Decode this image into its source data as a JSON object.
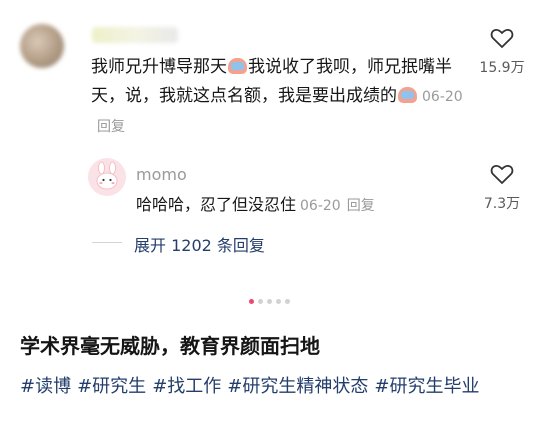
{
  "comment": {
    "text_parts": [
      "我师兄升博导那天",
      "我说收了我呗，师兄抿嘴半天，说，我就这点名额，我是要出成绩的"
    ],
    "date": "06-20",
    "reply_label": "回复",
    "like_count": "15.9万"
  },
  "sub_reply": {
    "username": "momo",
    "text": "哈哈哈，忍了但没忍住",
    "date": "06-20",
    "reply_label": "回复",
    "like_count": "7.3万"
  },
  "expand_label": "展开 1202 条回复",
  "carousel": {
    "total": 5,
    "active_index": 0,
    "active_color": "#f0466c"
  },
  "post": {
    "title": "学术界毫无威胁，教育界颜面扫地",
    "tags": [
      "#读博",
      "#研究生",
      "#找工作",
      "#研究生精神状态",
      "#研究生毕业"
    ]
  },
  "colors": {
    "link": "#233e6c",
    "muted": "#9a9a9a"
  },
  "icons": {
    "like": "heart-outline-icon",
    "emoji": "crying-emoji-icon"
  }
}
